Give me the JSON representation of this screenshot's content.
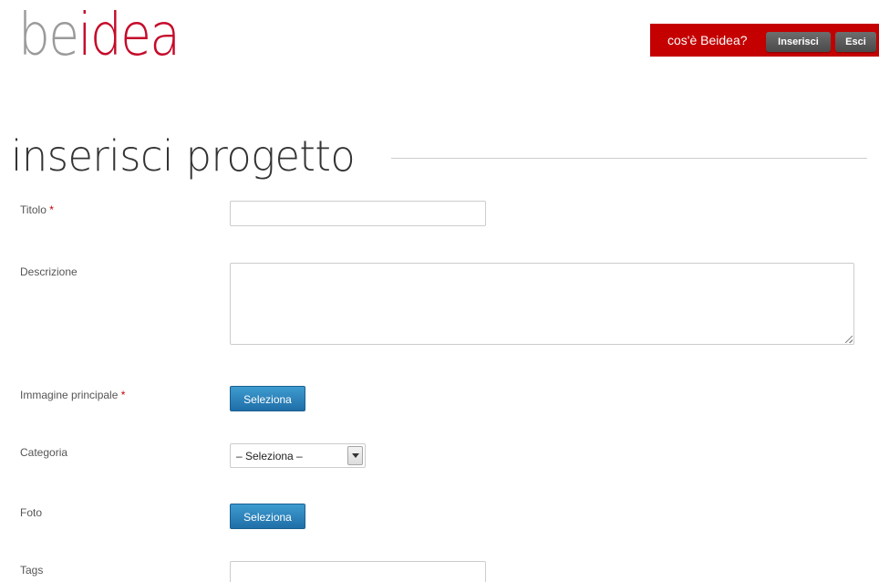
{
  "logo": {
    "part1": "be",
    "part2": "idea"
  },
  "nav": {
    "about_link": "cos'è Beidea?",
    "insert_button": "Inserisci",
    "exit_button": "Esci"
  },
  "page": {
    "title": "inserisci progetto"
  },
  "form": {
    "required_mark": "*",
    "title_label": "Titolo",
    "title_value": "",
    "description_label": "Descrizione",
    "description_value": "",
    "main_image_label": "Immagine principale",
    "main_image_button": "Seleziona",
    "category_label": "Categoria",
    "category_selected": "– Seleziona –",
    "photo_label": "Foto",
    "photo_button": "Seleziona",
    "tags_label": "Tags",
    "tags_value": ""
  },
  "colors": {
    "brand_red": "#c40000",
    "logo_red": "#c50a2a",
    "logo_gray": "#9a9a9a",
    "button_blue": "#2a84bd",
    "nav_button_gray": "#5a5a5a"
  }
}
